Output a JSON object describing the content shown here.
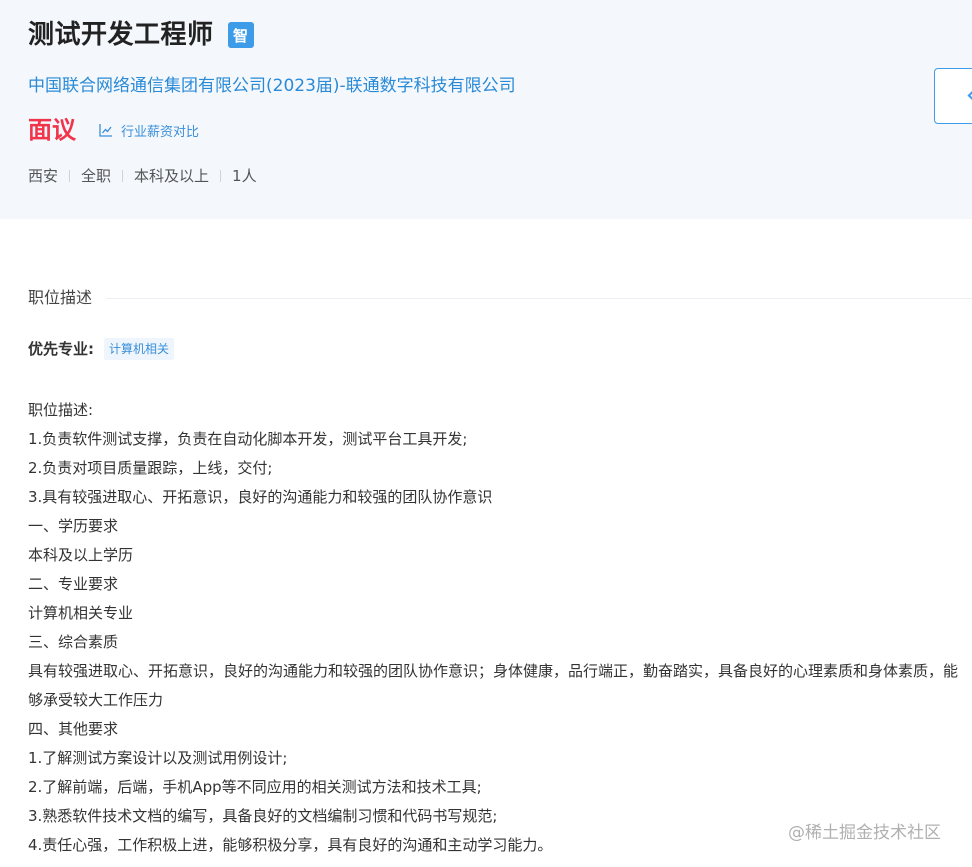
{
  "job": {
    "title": "测试开发工程师",
    "badge": "智",
    "company": "中国联合网络通信集团有限公司(2023届)-联通数字科技有限公司",
    "salary": "面议",
    "salary_compare": "行业薪资对比",
    "tags": [
      "西安",
      "全职",
      "本科及以上",
      "1人"
    ]
  },
  "section": {
    "title": "职位描述",
    "major_label": "优先专业:",
    "major_tag": "计算机相关",
    "lines": [
      "职位描述:",
      "1.负责软件测试支撑，负责在自动化脚本开发，测试平台工具开发;",
      "2.负责对项目质量跟踪，上线，交付;",
      "3.具有较强进取心、开拓意识，良好的沟通能力和较强的团队协作意识",
      "一、学历要求",
      "本科及以上学历",
      "二、专业要求",
      "计算机相关专业",
      "三、综合素质",
      "具有较强进取心、开拓意识，良好的沟通能力和较强的团队协作意识；身体健康，品行端正，勤奋踏实，具备良好的心理素质和身体素质，能够承受较大工作压力",
      "四、其他要求",
      "1.了解测试方案设计以及测试用例设计;",
      "2.了解前端，后端，手机App等不同应用的相关测试方法和技术工具;",
      "3.熟悉软件技术文档的编写，具备良好的文档编制习惯和代码书写规范;",
      "4.责任心强，工作积极上进，能够积极分享，具有良好的沟通和主动学习能力。"
    ]
  },
  "watermark": "@稀土掘金技术社区",
  "colors": {
    "link": "#2a8ad6",
    "salary": "#f2344a",
    "badge": "#3d9be8",
    "header_bg": "#f4f8fd"
  }
}
